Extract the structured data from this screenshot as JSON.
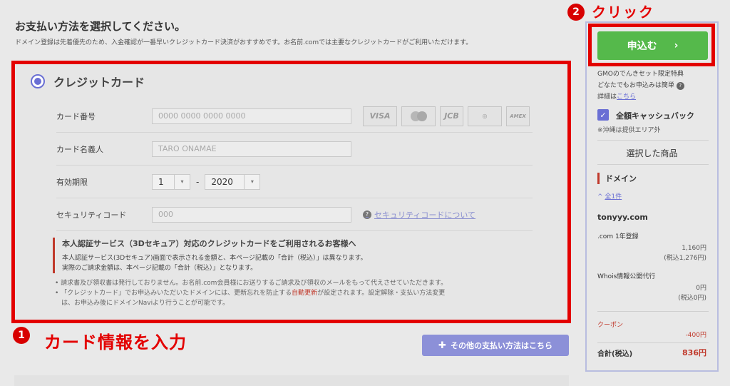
{
  "page": {
    "heading": "お支払い方法を選択してください。",
    "subnote": "ドメイン登録は先着優先のため、入金確認が一番早いクレジットカード決済がおすすめです。お名前.comでは主要なクレジットカードがご利用いただけます。"
  },
  "credit_card": {
    "title": "クレジットカード",
    "card_number_label": "カード番号",
    "card_number_placeholder": "0000 0000 0000 0000",
    "brands": [
      "VISA",
      "MasterCard",
      "JCB",
      "Diners Club",
      "AMEX"
    ],
    "card_name_label": "カード名義人",
    "card_name_placeholder": "TARO ONAMAE",
    "expiry_label": "有効期限",
    "expiry_month": "1",
    "expiry_separator": "-",
    "expiry_year": "2020",
    "security_label": "セキュリティコード",
    "security_placeholder": "000",
    "security_help": "セキュリティコードについて",
    "secure_title": "本人認証サービス（3Dセキュア）対応のクレジットカードをご利用されるお客様へ",
    "secure_line1": "本人認証サービス(3Dセキュア)画面で表示される金額と、本ページ記載の「合計（税込）」は異なります。",
    "secure_line2": "実際のご請求金額は、本ページ記載の「合計（税込）」となります。",
    "note1": "• 請求書及び領収書は発行しておりません。お名前.com会員様にお送りするご請求及び領収のメールをもって代えさせていただきます。",
    "note2_a": "• 「クレジットカード」でお申込みいただいたドメインには、更新忘れを防止する",
    "note2_link": "自動更新",
    "note2_b": "が設定されます。設定解除・支払い方法変更",
    "note3": "　は、お申込み後にドメインNaviより行うことが可能です。"
  },
  "annotations": {
    "step1_number": "1",
    "step1_text": "カード情報を入力",
    "step2_number": "2",
    "step2_text": "クリック"
  },
  "other_payment": {
    "label": "その他の支払い方法はこちら"
  },
  "sidebar": {
    "apply_label": "申込む",
    "promo_line1": "GMOのでんきセット限定特典",
    "promo_line2": "どなたでもお申込みは簡単",
    "promo_details": "詳細は",
    "promo_link": "こちら",
    "cashback_label": "全額キャッシュバック",
    "okinawa_note": "※沖縄は提供エリア外",
    "selected_title": "選択した商品",
    "domain_header": "ドメイン",
    "count_label": "全1件",
    "domain_name": "tonyyy.com",
    "reg_label": ".com 1年登録",
    "reg_price": "1,160円",
    "reg_price_tax": "(税込1,276円)",
    "whois_label": "Whois情報公開代行",
    "whois_price": "0円",
    "whois_price_tax": "(税込0円)",
    "coupon_label": "クーポン",
    "coupon_value": "-400円",
    "total_label": "合計(税込)",
    "total_value": "836円"
  }
}
